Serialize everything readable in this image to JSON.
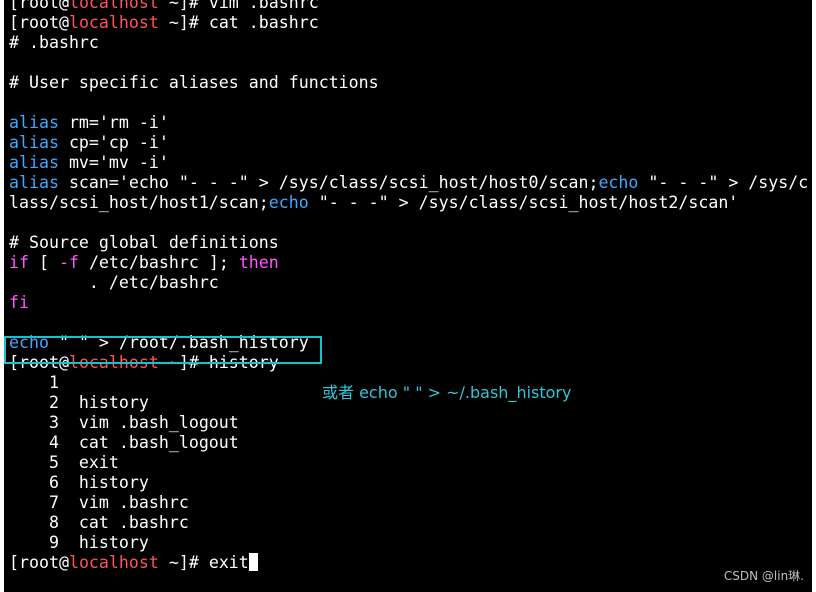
{
  "terminal": {
    "prompt": {
      "open": "[root@",
      "host": "localhost",
      "close": " ~]# "
    },
    "commands": {
      "vim": "vim .bashrc",
      "cat": "cat .bashrc",
      "history": "history",
      "exit": "exit"
    },
    "bashrc": {
      "header": "# .bashrc",
      "aliases_comment": "# User specific aliases and functions",
      "kw_alias": "alias",
      "alias_rm": " rm='rm -i'",
      "alias_cp": " cp='cp -i'",
      "alias_mv": " mv='mv -i'",
      "scan_a": " scan='echo \"- - -\" > /sys/class/scsi_host/host0/scan;",
      "kw_echo": "echo",
      "scan_b": " \"- - -\" > /sys/c",
      "scan_c": "lass/scsi_host/host1/scan;",
      "scan_d": " \"- - -\" > /sys/class/scsi_host/host2/scan'",
      "source_comment": "# Source global definitions",
      "kw_if": "if",
      "if_mid": " [ ",
      "opt_f": "-f",
      "if_rest": " /etc/bashrc ]; ",
      "kw_then": "then",
      "source_line": "        . /etc/bashrc",
      "kw_fi": "fi",
      "echo_rest": " \" \" > /root/.bash_history"
    },
    "history_entries": [
      {
        "num": "    1",
        "cmd": ""
      },
      {
        "num": "    2",
        "cmd": "  history"
      },
      {
        "num": "    3",
        "cmd": "  vim .bash_logout"
      },
      {
        "num": "    4",
        "cmd": "  cat .bash_logout"
      },
      {
        "num": "    5",
        "cmd": "  exit"
      },
      {
        "num": "    6",
        "cmd": "  history"
      },
      {
        "num": "    7",
        "cmd": "  vim .bashrc"
      },
      {
        "num": "    8",
        "cmd": "  cat .bashrc"
      },
      {
        "num": "    9",
        "cmd": "  history"
      }
    ]
  },
  "annotation": "或者 echo \" \" > ~/.bash_history",
  "watermark": "CSDN @lin琳.",
  "colors": {
    "background": "#000000",
    "text": "#ffffff",
    "hostname": "#ff5555",
    "keyword": "#3fa9ff",
    "option": "#ff55ff",
    "highlight_box": "#17c3c9",
    "annotation": "#33c5d9"
  }
}
